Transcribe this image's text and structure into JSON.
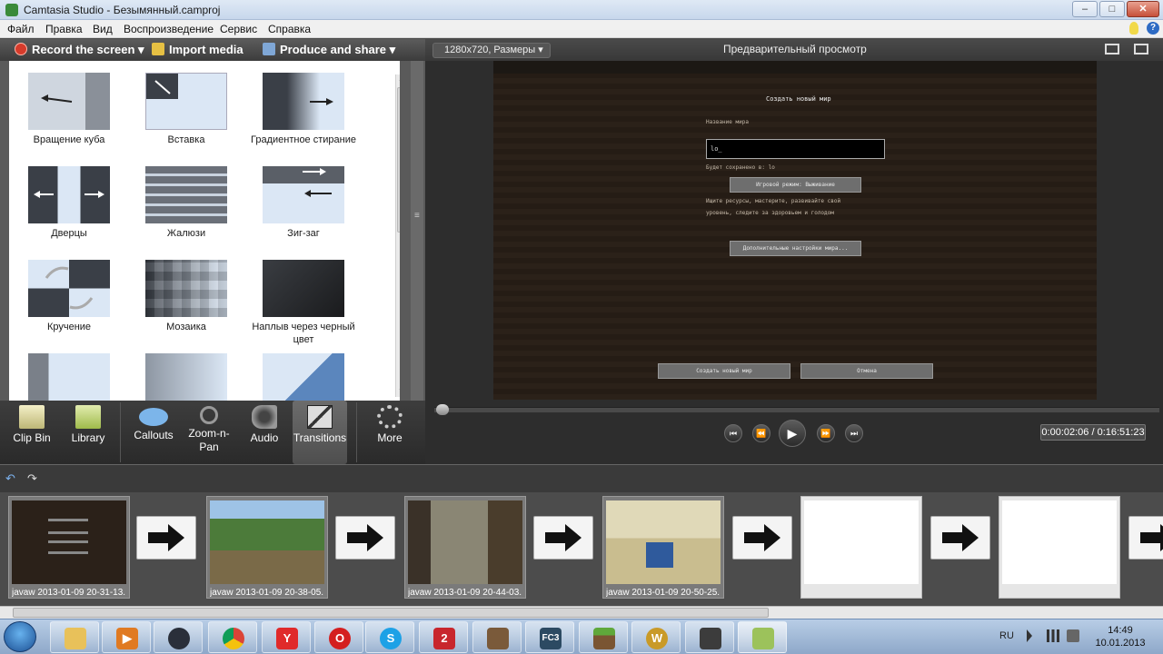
{
  "window": {
    "title": "Camtasia Studio - Безымянный.camproj",
    "min_label": "–",
    "max_label": "□",
    "close_label": "✕"
  },
  "menu": [
    "Файл",
    "Правка",
    "Вид",
    "Воспроизведение",
    "Сервис",
    "Справка"
  ],
  "toolbar": {
    "record_label": "Record the screen",
    "import_label": "Import media",
    "produce_label": "Produce and share"
  },
  "transitions": [
    {
      "label": "Вращение куба",
      "icon": "cube-rotate-thumbnail"
    },
    {
      "label": "Вставка",
      "icon": "insert-thumbnail"
    },
    {
      "label": "Градиентное стирание",
      "icon": "gradient-wipe-thumbnail"
    },
    {
      "label": "Дверцы",
      "icon": "doors-thumbnail"
    },
    {
      "label": "Жалюзи",
      "icon": "blinds-thumbnail"
    },
    {
      "label": "Зиг-заг",
      "icon": "zigzag-thumbnail"
    },
    {
      "label": "Кручение",
      "icon": "spin-thumbnail"
    },
    {
      "label": "Мозаика",
      "icon": "mosaic-thumbnail"
    },
    {
      "label": "Наплыв через черный цвет",
      "icon": "fade-through-black-thumbnail"
    }
  ],
  "tools": {
    "clip_bin": "Clip Bin",
    "library": "Library",
    "callouts": "Callouts",
    "zoom_pan": "Zoom-n-Pan",
    "audio": "Audio",
    "transitions": "Transitions",
    "more": "More"
  },
  "preview": {
    "size_select": "1280x720, Размеры",
    "title": "Предварительный просмотр",
    "screen": {
      "heading": "Создать новый мир",
      "field_label": "Название мира",
      "field_value": "lo_",
      "save_note": "Будет сохранено в: lo",
      "mode_button": "Игровой режим: Выживание",
      "desc_line1": "Ищите ресурсы, мастерите, развивайте свой",
      "desc_line2": "уровень, следите за здоровьем и голодом",
      "more_options_button": "Дополнительные настройки мира...",
      "create_button": "Создать новый мир",
      "cancel_button": "Отмена"
    },
    "time": "0:00:02:06 / 0:16:51:23",
    "playhead_fraction": 0.002
  },
  "timeline": {
    "clips": [
      {
        "label": "javaw 2013-01-09 20-31-13...",
        "kind": "menu"
      },
      {
        "label": "javaw 2013-01-09 20-38-05...",
        "kind": "field"
      },
      {
        "label": "javaw 2013-01-09 20-44-03...",
        "kind": "room"
      },
      {
        "label": "javaw 2013-01-09 20-50-25...",
        "kind": "sand"
      },
      {
        "label": "",
        "kind": "blank"
      },
      {
        "label": "",
        "kind": "blank"
      }
    ]
  },
  "taskbar": {
    "apps": [
      "explorer",
      "media-player",
      "steam",
      "chrome",
      "yandex",
      "opera",
      "skype",
      "2gis",
      "game",
      "fc3",
      "minecraft",
      "wow",
      "camtasia-recorder",
      "camtasia-studio"
    ],
    "language": "RU",
    "time": "14:49",
    "date": "10.01.2013"
  },
  "colors": {
    "accent_blue": "#2e6bc4",
    "record_red": "#d63b2b",
    "panel_dark": "#3a3a3a"
  }
}
